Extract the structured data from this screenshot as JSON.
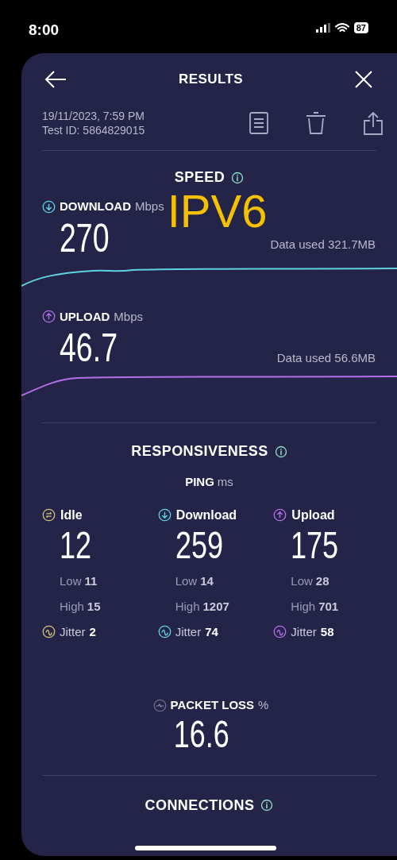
{
  "status_bar": {
    "time": "8:00",
    "battery": "87"
  },
  "header": {
    "title": "RESULTS"
  },
  "test": {
    "date": "19/11/2023, 7:59 PM",
    "test_id": "Test ID: 5864829015"
  },
  "speed": {
    "title": "SPEED",
    "overlay_label": "IPV6",
    "metrics": [
      {
        "kind": "download",
        "label": "DOWNLOAD",
        "unit": "Mbps",
        "value": "270",
        "data_used": "Data used 321.7MB",
        "color": "#5fd4e0"
      },
      {
        "kind": "upload",
        "label": "UPLOAD",
        "unit": "Mbps",
        "value": "46.7",
        "data_used": "Data used 56.6MB",
        "color": "#b46ee8"
      }
    ]
  },
  "responsiveness": {
    "title": "RESPONSIVENESS",
    "ping": {
      "label": "PING",
      "unit": "ms"
    },
    "columns": [
      {
        "kind": "idle",
        "label": "Idle",
        "value": "12",
        "low_label": "Low",
        "low": "11",
        "high_label": "High",
        "high": "15",
        "jitter_label": "Jitter",
        "jitter": "2",
        "color": "#d8c27a"
      },
      {
        "kind": "download",
        "label": "Download",
        "value": "259",
        "low_label": "Low",
        "low": "14",
        "high_label": "High",
        "high": "1207",
        "jitter_label": "Jitter",
        "jitter": "74",
        "color": "#5fd4e0"
      },
      {
        "kind": "upload",
        "label": "Upload",
        "value": "175",
        "low_label": "Low",
        "low": "28",
        "high_label": "High",
        "high": "701",
        "jitter_label": "Jitter",
        "jitter": "58",
        "color": "#b46ee8"
      }
    ]
  },
  "packet_loss": {
    "label": "PACKET LOSS",
    "unit": "%",
    "value": "16.6"
  },
  "connections": {
    "title": "CONNECTIONS"
  }
}
